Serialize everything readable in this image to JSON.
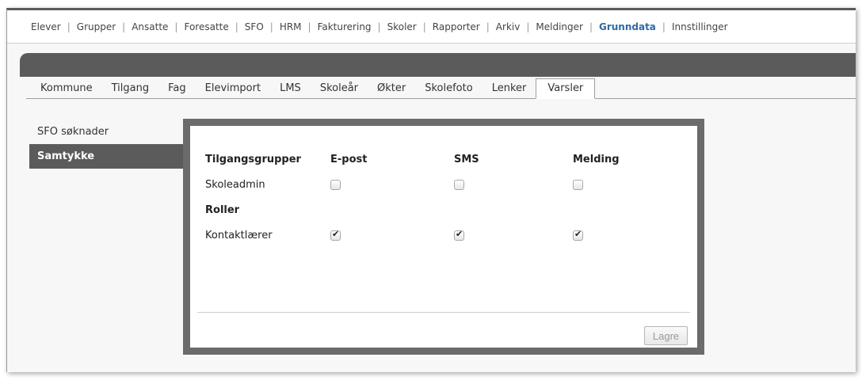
{
  "topnav": {
    "items": [
      {
        "label": "Elever"
      },
      {
        "label": "Grupper"
      },
      {
        "label": "Ansatte"
      },
      {
        "label": "Foresatte"
      },
      {
        "label": "SFO"
      },
      {
        "label": "HRM"
      },
      {
        "label": "Fakturering"
      },
      {
        "label": "Skoler"
      },
      {
        "label": "Rapporter"
      },
      {
        "label": "Arkiv"
      },
      {
        "label": "Meldinger"
      },
      {
        "label": "Grunndata",
        "active": true
      },
      {
        "label": "Innstillinger"
      }
    ]
  },
  "tabs": {
    "items": [
      {
        "label": "Kommune"
      },
      {
        "label": "Tilgang"
      },
      {
        "label": "Fag"
      },
      {
        "label": "Elevimport"
      },
      {
        "label": "LMS"
      },
      {
        "label": "Skoleår"
      },
      {
        "label": "Økter"
      },
      {
        "label": "Skolefoto"
      },
      {
        "label": "Lenker"
      },
      {
        "label": "Varsler",
        "active": true
      }
    ]
  },
  "sidemenu": {
    "items": [
      {
        "label": "SFO søknader"
      },
      {
        "label": "Samtykke",
        "active": true
      }
    ]
  },
  "notify": {
    "headers": {
      "group": "Tilgangsgrupper",
      "email": "E-post",
      "sms": "SMS",
      "message": "Melding"
    },
    "group_rows": [
      {
        "label": "Skoleadmin",
        "email": false,
        "sms": false,
        "message": false
      }
    ],
    "roles_header": "Roller",
    "role_rows": [
      {
        "label": "Kontaktlærer",
        "email": true,
        "sms": true,
        "message": true
      }
    ],
    "save_label": "Lagre"
  }
}
